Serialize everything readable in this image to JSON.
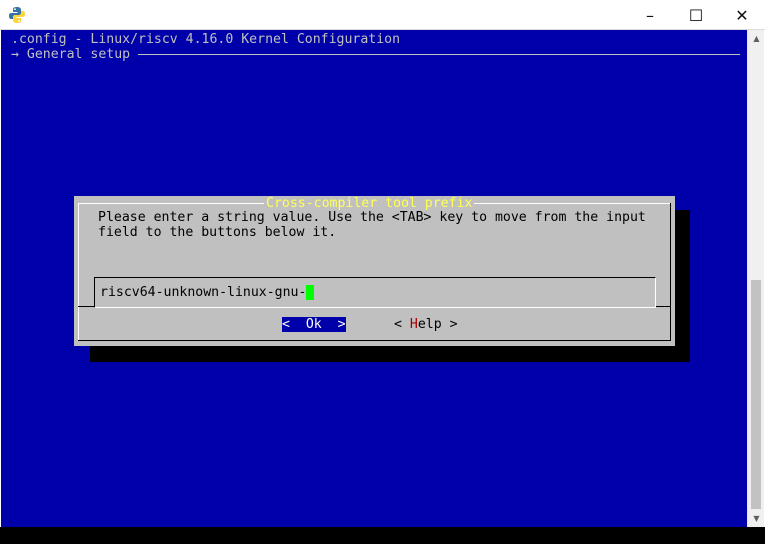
{
  "window": {
    "app_icon": "python-icon",
    "controls": {
      "minimize": "–",
      "maximize": "☐",
      "close": "✕"
    }
  },
  "terminal": {
    "header_line": ".config - Linux/riscv 4.16.0 Kernel Configuration",
    "breadcrumb": "→ General setup"
  },
  "dialog": {
    "title": "Cross-compiler tool prefix",
    "prompt_line1": "Please enter a string value. Use the <TAB> key to move from the input",
    "prompt_line2": "field to the buttons below it.",
    "input_value": "riscv64-unknown-linux-gnu-",
    "ok_left": "<  ",
    "ok_label": "Ok",
    "ok_right": "  >",
    "help_left": "< ",
    "help_hotkey": "H",
    "help_rest": "elp",
    "help_right": " >"
  },
  "colors": {
    "terminal_bg": "#0000aa",
    "dialog_bg": "#c0c0c0",
    "title_fg": "#ffff55",
    "cursor": "#00ff00",
    "hotkey": "#aa0000"
  }
}
